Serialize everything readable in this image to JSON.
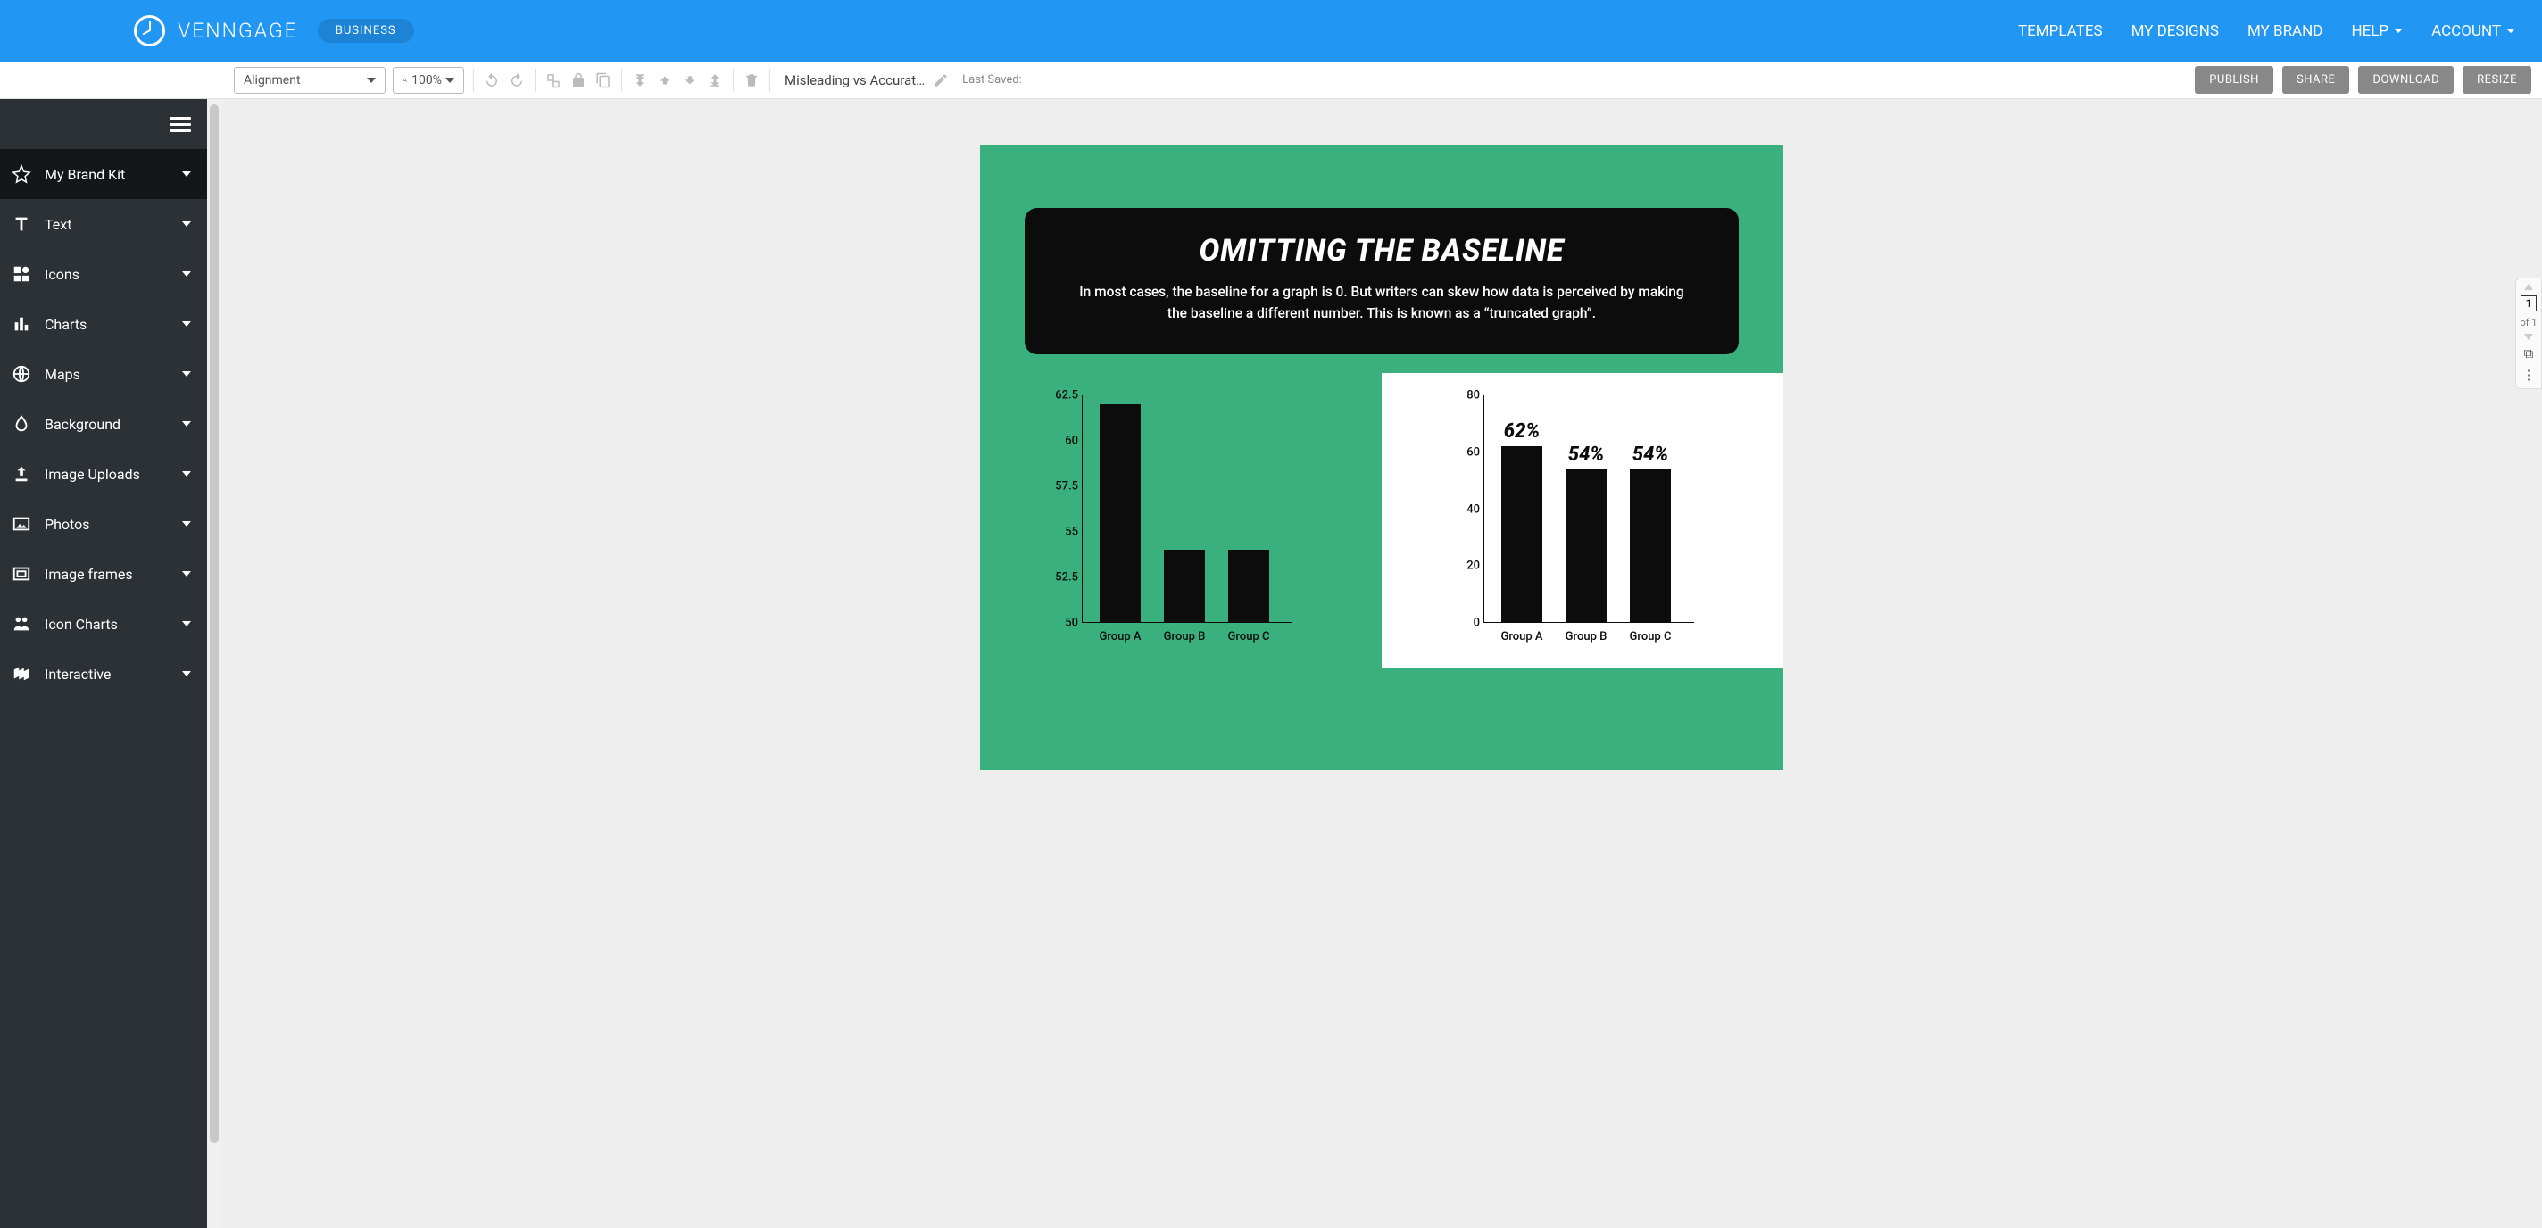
{
  "brand": "VENNGAGE",
  "plan": "BUSINESS",
  "top_nav": {
    "templates": "TEMPLATES",
    "mydesigns": "MY DESIGNS",
    "mybrand": "MY BRAND",
    "help": "HELP",
    "account": "ACCOUNT"
  },
  "toolbar": {
    "alignment_label": "Alignment",
    "zoom": "100%",
    "doc_title": "Misleading vs Accurat…",
    "last_saved": "Last Saved:"
  },
  "action_buttons": {
    "publish": "PUBLISH",
    "share": "SHARE",
    "download": "DOWNLOAD",
    "resize": "RESIZE"
  },
  "sidebar": {
    "items": [
      "My Brand Kit",
      "Text",
      "Icons",
      "Charts",
      "Maps",
      "Background",
      "Image Uploads",
      "Photos",
      "Image frames",
      "Icon Charts",
      "Interactive"
    ]
  },
  "pager": {
    "current": "1",
    "of": "of 1"
  },
  "infographic": {
    "title": "OMITTING THE BASELINE",
    "subtitle": "In most cases, the baseline for a graph is 0. But writers can skew how data is perceived by making the baseline a different number. This is known as a “truncated graph”."
  },
  "chart_data": [
    {
      "type": "bar",
      "categories": [
        "Group A",
        "Group B",
        "Group C"
      ],
      "values": [
        62,
        54,
        54
      ],
      "ylim": [
        50,
        62.5
      ],
      "y_ticks": [
        50,
        52.5,
        55,
        57.5,
        60,
        62.5
      ],
      "title": "",
      "xlabel": "",
      "ylabel": ""
    },
    {
      "type": "bar",
      "categories": [
        "Group A",
        "Group B",
        "Group C"
      ],
      "values": [
        62,
        54,
        54
      ],
      "value_labels": [
        "62%",
        "54%",
        "54%"
      ],
      "ylim": [
        0,
        80
      ],
      "y_ticks": [
        0,
        20,
        40,
        60,
        80
      ],
      "title": "",
      "xlabel": "",
      "ylabel": ""
    }
  ]
}
